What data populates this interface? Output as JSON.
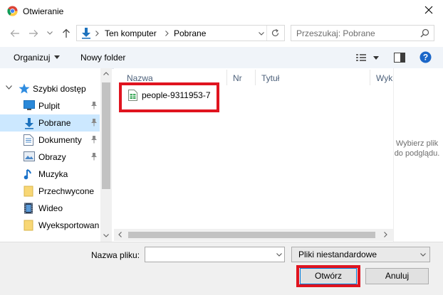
{
  "window": {
    "title": "Otwieranie"
  },
  "address": {
    "segments": [
      "Ten komputer",
      "Pobrane"
    ]
  },
  "search": {
    "placeholder": "Przeszukaj: Pobrane"
  },
  "toolbar": {
    "organize": "Organizuj",
    "new_folder": "Nowy folder"
  },
  "nav": {
    "quick_access": "Szybki dostęp",
    "items": [
      {
        "label": "Pulpit",
        "icon": "desktop-icon",
        "pinned": true
      },
      {
        "label": "Pobrane",
        "icon": "download-icon",
        "pinned": true,
        "selected": true
      },
      {
        "label": "Dokumenty",
        "icon": "documents-icon",
        "pinned": true
      },
      {
        "label": "Obrazy",
        "icon": "pictures-icon",
        "pinned": true
      },
      {
        "label": "Muzyka",
        "icon": "music-icon",
        "pinned": false
      },
      {
        "label": "Przechwycone",
        "icon": "folder-icon",
        "pinned": false
      },
      {
        "label": "Wideo",
        "icon": "video-icon",
        "pinned": false
      },
      {
        "label": "Wyeksportowan",
        "icon": "folder-icon",
        "pinned": false
      }
    ]
  },
  "columns": [
    "Nazwa",
    "Nr",
    "Tytuł",
    "Wyk"
  ],
  "files": [
    {
      "name": "people-9311953-7",
      "icon": "spreadsheet-file-icon"
    }
  ],
  "preview": {
    "text": "Wybierz plik do podglądu."
  },
  "bottom": {
    "filename_label": "Nazwa pliku:",
    "filename_value": "",
    "filetype": "Pliki niestandardowe",
    "open": "Otwórz",
    "cancel": "Anuluj"
  },
  "colors": {
    "highlight": "#e0141f",
    "selection": "#cce8ff",
    "accent": "#1e73be"
  }
}
